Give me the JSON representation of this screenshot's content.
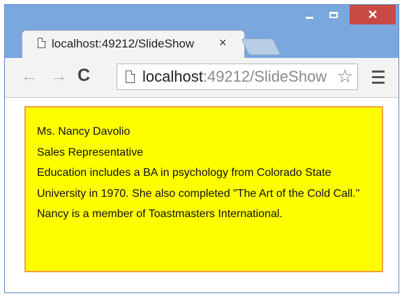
{
  "window": {
    "min_icon": "minimize-icon",
    "max_icon": "maximize-icon",
    "close_label": "✕"
  },
  "tab": {
    "title": "localhost:49212/SlideShow",
    "close_label": "×"
  },
  "toolbar": {
    "back_label": "←",
    "forward_label": "→",
    "reload_label": "C",
    "url_host": "localhost",
    "url_rest": ":49212/SlideShow",
    "star_label": "☆"
  },
  "card": {
    "name": "Ms. Nancy Davolio",
    "title": "Sales Representative",
    "notes": "Education includes a BA in psychology from Colorado State University in 1970. She also completed \"The Art of the Cold Call.\" Nancy is a member of Toastmasters International.",
    "background": "#ffff00",
    "border": "#f0a040"
  }
}
